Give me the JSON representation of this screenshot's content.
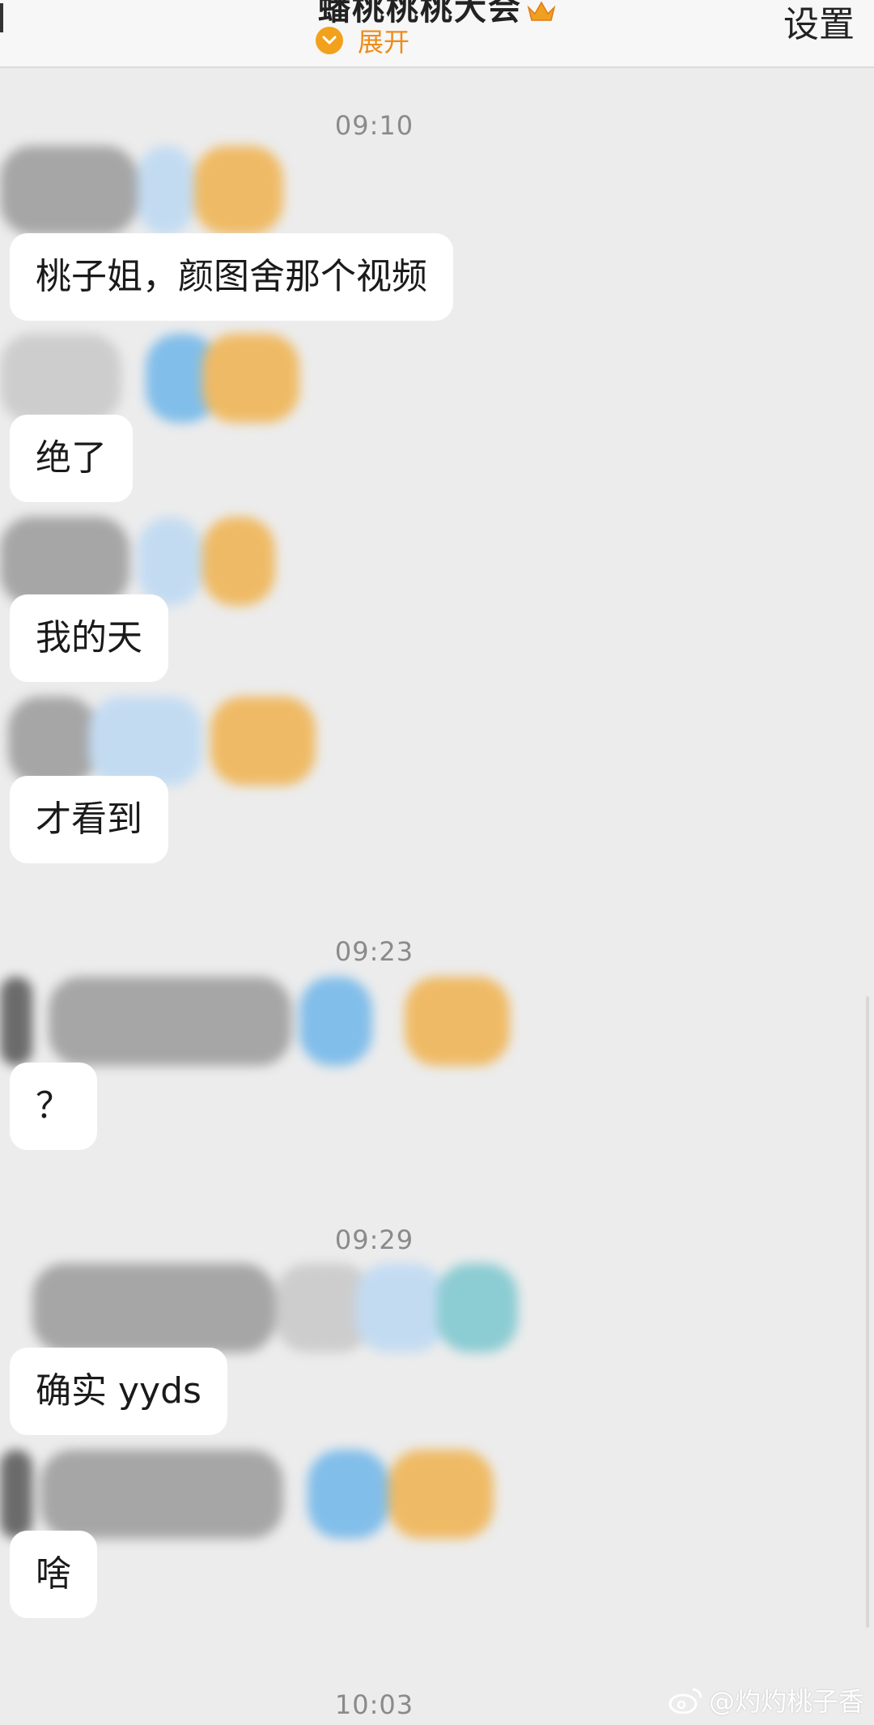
{
  "header": {
    "title": "蟠桃桃桃大会",
    "expand_label": "展开",
    "settings_label": "设置"
  },
  "messages": [
    {
      "time": "09:10"
    },
    {
      "text": "桃子姐，颜图舍那个视频"
    },
    {
      "text": "绝了"
    },
    {
      "text": "我的天"
    },
    {
      "text": "才看到"
    },
    {
      "time": "09:23"
    },
    {
      "text": "？"
    },
    {
      "time": "09:29"
    },
    {
      "text": "确实 yyds"
    },
    {
      "text": "啥"
    },
    {
      "time": "10:03"
    }
  ],
  "watermark": "@灼灼桃子香",
  "colors": {
    "background": "#ececec",
    "header": "#f7f7f7",
    "accent_orange": "#ee8c18",
    "bubble": "#ffffff"
  }
}
